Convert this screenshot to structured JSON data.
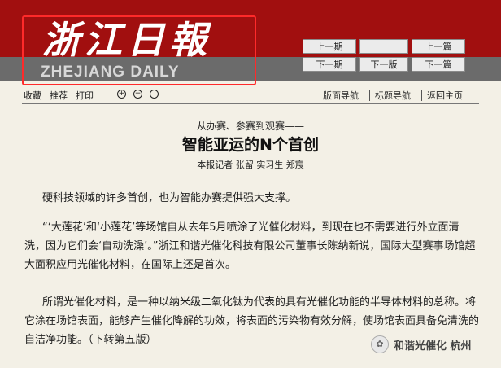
{
  "masthead": {
    "logo_cn": "浙江日報",
    "logo_en": "ZHEJIANG DAILY"
  },
  "page_nav": {
    "prev_issue": "上一期",
    "next_issue": "下一期",
    "prev_page": "",
    "next_page": "下一版",
    "prev_article": "上一篇",
    "next_article": "下一篇"
  },
  "toolbar": {
    "favorite": "收藏",
    "recommend": "推荐",
    "print": "打印",
    "zoom_in": "+",
    "zoom_out": "−",
    "zoom_reset": "",
    "page_nav": "版面导航",
    "title_nav": "标题导航",
    "home": "返回主页"
  },
  "article": {
    "kicker": "从办赛、参赛到观赛——",
    "headline": "智能亚运的N个首创",
    "byline": "本报记者 张留 实习生 郑宸",
    "paragraphs": [
      "硬科技领域的许多首创，也为智能办赛提供强大支撑。",
      "“‘大莲花’和‘小莲花’等场馆自从去年5月喷涂了光催化材料，到现在也不需要进行外立面清洗，因为它们会‘自动洗澡’。”浙江和谐光催化科技有限公司董事长陈纳新说，国际大型赛事场馆超大面积应用光催化材料，在国际上还是首次。",
      "所谓光催化材料，是一种以纳米级二氧化钛为代表的具有光催化功能的半导体材料的总称。将它涂在场馆表面，能够产生催化降解的功效，将表面的污染物有效分解，使场馆表面具备免清洗的自洁净功能。（下转第五版）"
    ]
  },
  "watermark": {
    "text": "和谐光催化 杭州",
    "icon": "wechat-icon"
  },
  "colors": {
    "masthead_red": "#a10f0f",
    "band_gray": "#6b6b6b",
    "page_bg": "#f3f0e6",
    "highlight_red": "#ff2a2a"
  }
}
